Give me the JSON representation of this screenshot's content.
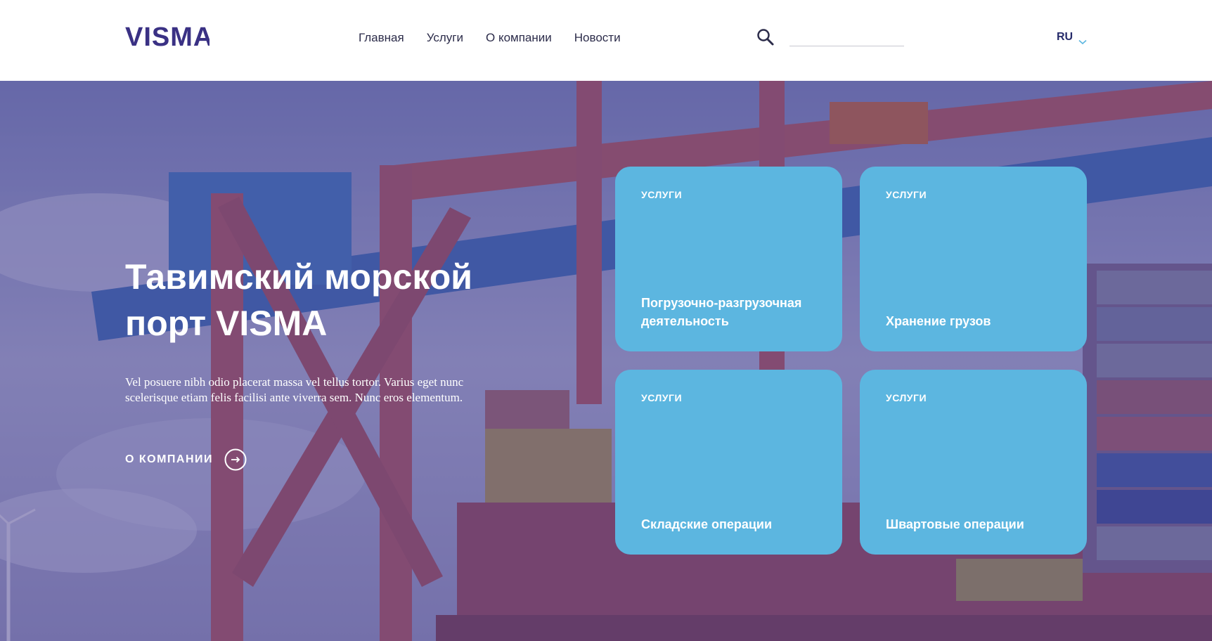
{
  "header": {
    "logo_text": "VISMA",
    "nav": [
      {
        "label": "Главная"
      },
      {
        "label": "Услуги"
      },
      {
        "label": "О компании"
      },
      {
        "label": "Новости"
      }
    ],
    "search": {
      "value": "",
      "placeholder": ""
    },
    "language": "RU",
    "icons": {
      "search": "search-icon",
      "language_toggle": "chevron-down-icon"
    }
  },
  "hero": {
    "title": "Тавимский морской порт VISMA",
    "text": "Vel posuere nibh odio placerat massa vel tellus tortor. Varius eget nunc scelerisque etiam felis facilisi ante viverra sem. Nunc eros elementum.",
    "about_label": "О КОМПАНИИ",
    "about_icon": "arrow-right-circle-icon",
    "background": "photo of container port with cranes and container ship"
  },
  "cards": [
    {
      "tag": "УСЛУГИ",
      "title": "Погрузочно-разгрузочная деятельность"
    },
    {
      "tag": "УСЛУГИ",
      "title": "Хранение грузов"
    },
    {
      "tag": "УСЛУГИ",
      "title": "Складские операции"
    },
    {
      "tag": "УСЛУГИ",
      "title": "Швартовые операции"
    }
  ],
  "colors": {
    "brand": "#3a3184",
    "card": "#5cb6e0",
    "overlay": "#463c8c",
    "text_dark": "#2c2c4a"
  }
}
